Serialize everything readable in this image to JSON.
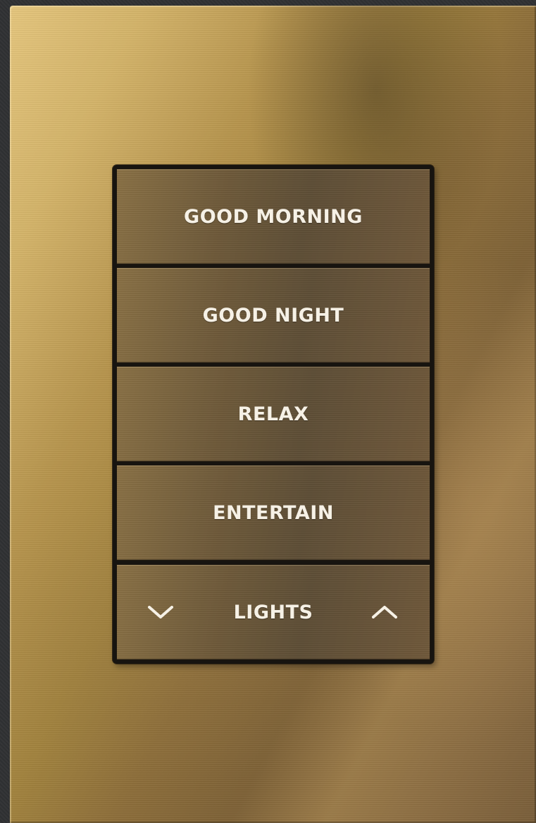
{
  "keypad": {
    "buttons": [
      {
        "label": "GOOD MORNING"
      },
      {
        "label": "GOOD NIGHT"
      },
      {
        "label": "RELAX"
      },
      {
        "label": "ENTERTAIN"
      }
    ],
    "lights": {
      "label": "LIGHTS",
      "down_icon": "chevron-down-icon",
      "up_icon": "chevron-up-icon"
    }
  },
  "colors": {
    "plate_gold": "#b8964f",
    "key_bronze": "#6e5a3a",
    "label_white": "#f6f1e6"
  }
}
